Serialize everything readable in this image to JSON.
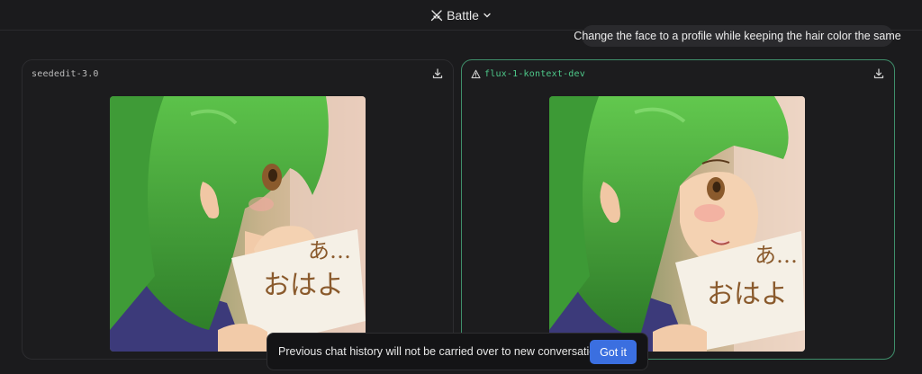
{
  "header": {
    "mode_label": "Battle",
    "mode_icon": "swords-icon",
    "dropdown_icon": "chevron-down-icon"
  },
  "prompt": {
    "text": "Change the face to a profile while keeping the hair color the same"
  },
  "panels": [
    {
      "model": "seededit-3.0",
      "warning": false,
      "download_icon": "download-icon"
    },
    {
      "model": "flux-1-kontext-dev",
      "warning": true,
      "warning_icon": "warning-triangle-icon",
      "download_icon": "download-icon",
      "accent": "#3f8f6b"
    }
  ],
  "toast": {
    "message": "Previous chat history will not be carried over to new conversations",
    "button_label": "Got it",
    "button_color": "#3b6fe0"
  },
  "colors": {
    "background": "#1b1b1d",
    "hair": "#3a9a3a",
    "skin": "#f0c9a8"
  }
}
